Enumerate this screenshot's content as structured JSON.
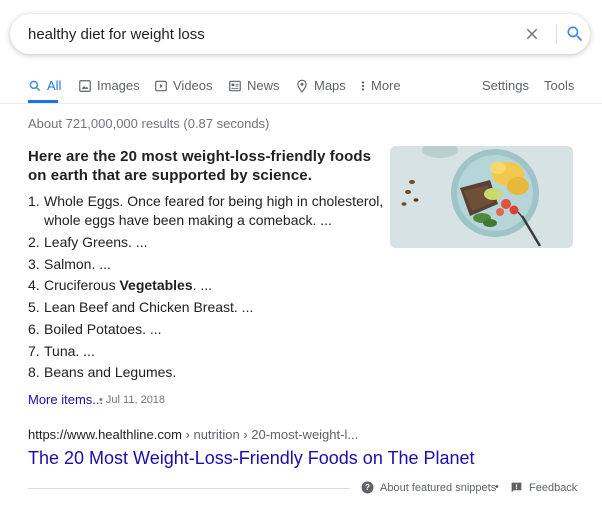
{
  "search": {
    "query": "healthy diet for weight loss"
  },
  "tabs": [
    {
      "label": "All"
    },
    {
      "label": "Images"
    },
    {
      "label": "Videos"
    },
    {
      "label": "News"
    },
    {
      "label": "Maps"
    },
    {
      "label": "More"
    }
  ],
  "tools": {
    "settings": "Settings",
    "tools": "Tools"
  },
  "stats": "About 721,000,000 results (0.87 seconds)",
  "snippet": {
    "heading": "Here are the 20 most weight-loss-friendly foods on earth that are supported by science.",
    "items": [
      {
        "num": "1.",
        "text": "Whole Eggs. Once feared for being high in cholesterol, whole eggs have been making a comeback. ..."
      },
      {
        "num": "2.",
        "text": "Leafy Greens. ..."
      },
      {
        "num": "3.",
        "text": "Salmon. ..."
      },
      {
        "num": "4.",
        "before": "Cruciferous ",
        "bold": "Vegetables",
        "after": ". ..."
      },
      {
        "num": "5.",
        "text": "Lean Beef and Chicken Breast. ..."
      },
      {
        "num": "6.",
        "text": "Boiled Potatoes. ..."
      },
      {
        "num": "7.",
        "text": "Tuna. ..."
      },
      {
        "num": "8.",
        "text": "Beans and Legumes."
      }
    ],
    "more_items": "More items...",
    "date": "Jul 11, 2018"
  },
  "result": {
    "url_base": "https://www.healthline.com",
    "url_crumbs": " › nutrition › 20-most-weight-l...",
    "title": "The 20 Most Weight-Loss-Friendly Foods on The Planet"
  },
  "footer": {
    "about": "About featured snippets",
    "separator": "•",
    "feedback": "Feedback"
  },
  "colors": {
    "link": "#1a0dab",
    "accent": "#1a73e8",
    "muted": "#70757a"
  }
}
